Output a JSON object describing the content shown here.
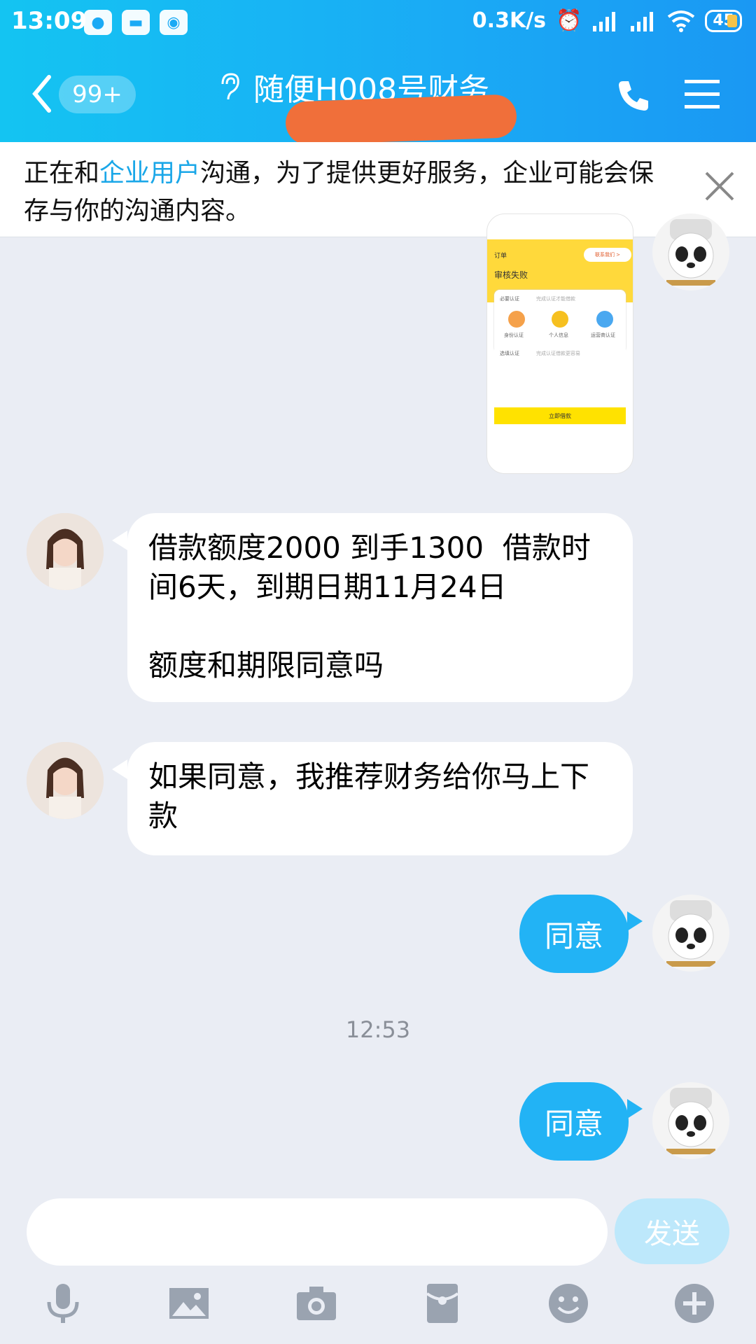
{
  "status_bar": {
    "time": "13:09",
    "speed": "0.3K/s",
    "battery": "45",
    "left_icons": [
      "wechat-icon",
      "app-icon",
      "qq-icon"
    ],
    "right_icons": [
      "alarm-icon",
      "signal-icon",
      "signal-icon",
      "wifi-icon",
      "battery-icon"
    ]
  },
  "header": {
    "back_badge": "99+",
    "title": "随便H008号财务",
    "icons": [
      "ear-icon",
      "phone-icon",
      "menu-icon"
    ]
  },
  "notice": {
    "prefix": "正在和",
    "link": "企业用户",
    "suffix": "沟通，为了提供更好服务，企业可能会保存与你的沟通内容。"
  },
  "messages": {
    "img_msg": {
      "t1": "订单",
      "t2": "审核失败",
      "pill": "联系我们 >",
      "card_title": "必要认证",
      "card_hint": "完成认证才能借款",
      "opt1": "身份认证",
      "opt2": "个人信息",
      "opt3": "运营商认证",
      "card2_title": "选填认证",
      "card2_hint": "完成认证借款更容易",
      "btn": "立即借款"
    },
    "msg1": "借款额度2000 到手1300  借款时间6天，到期日期11月24日\n\n额度和期限同意吗",
    "msg2": "如果同意，我推荐财务给你马上下款",
    "reply1": "同意",
    "time": "12:53",
    "reply2": "同意"
  },
  "input": {
    "placeholder": "",
    "send_label": "发送"
  },
  "toolbar": {
    "icons": [
      "microphone-icon",
      "image-icon",
      "camera-icon",
      "red-packet-icon",
      "emoji-icon",
      "plus-icon"
    ]
  },
  "colors": {
    "header": "#1aaaf5",
    "bubble_out": "#22b3f5",
    "background": "#eaedf4",
    "link": "#1aa7e8"
  }
}
